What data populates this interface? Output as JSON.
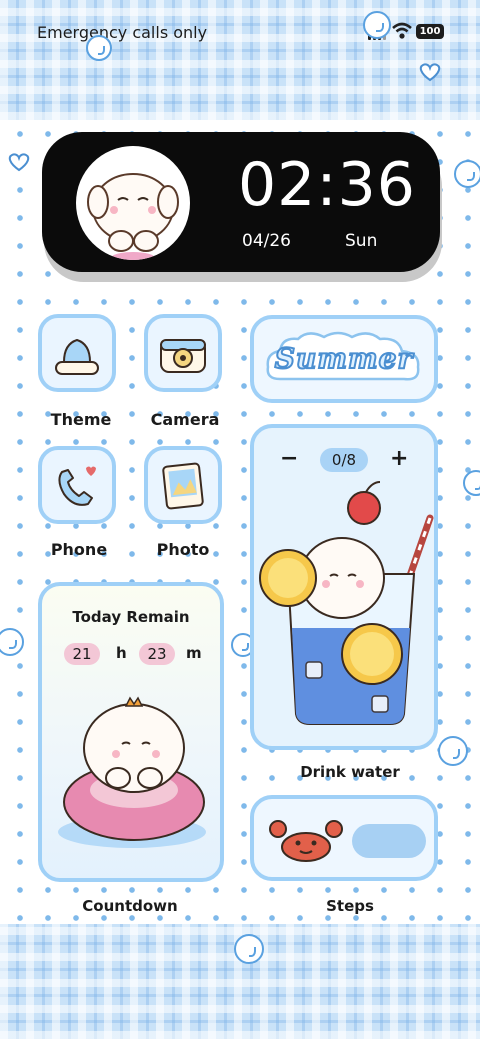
{
  "status_bar": {
    "carrier_text": "Emergency calls only",
    "battery": "100",
    "signal_icon": "signal-bars-icon",
    "wifi_icon": "wifi-icon"
  },
  "clock_widget": {
    "time": "02:36",
    "date": "04/26",
    "weekday": "Sun"
  },
  "apps": [
    {
      "label": "Theme",
      "icon": "theme-icon"
    },
    {
      "label": "Camera",
      "icon": "camera-icon"
    },
    {
      "label": "Phone",
      "icon": "phone-icon"
    },
    {
      "label": "Photo",
      "icon": "photo-icon"
    }
  ],
  "summer_widget": {
    "text": "Summer"
  },
  "drink_water": {
    "minus": "−",
    "plus": "+",
    "count": "0/8",
    "label": "Drink water"
  },
  "countdown": {
    "title": "Today Remain",
    "hours": "21",
    "hours_unit": "h",
    "minutes": "23",
    "minutes_unit": "m",
    "label": "Countdown"
  },
  "steps": {
    "label": "Steps"
  },
  "colors": {
    "accent_blue": "#9fd0f7",
    "pill_pink": "#f3c7d6",
    "dot_blue": "#7fb9ea"
  }
}
